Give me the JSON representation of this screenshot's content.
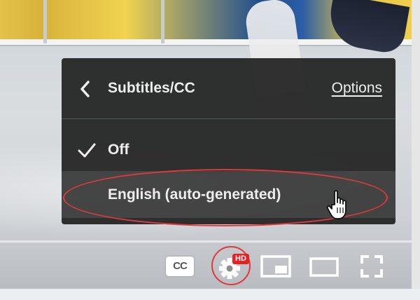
{
  "menu": {
    "title": "Subtitles/CC",
    "options_link": "Options",
    "items": [
      {
        "label": "Off",
        "selected": true
      },
      {
        "label": "English (auto-generated)",
        "selected": false,
        "hovered": true
      }
    ]
  },
  "controls": {
    "cc_label": "CC",
    "quality_badge": "HD",
    "icons": [
      "subtitles-icon",
      "settings-gear-icon",
      "miniplayer-icon",
      "theater-mode-icon",
      "fullscreen-icon"
    ]
  },
  "colors": {
    "menu_bg": "#1c1c1c",
    "menu_text": "#eeeeee",
    "hd_badge": "#e52222",
    "annotation": "#e03a3a"
  }
}
